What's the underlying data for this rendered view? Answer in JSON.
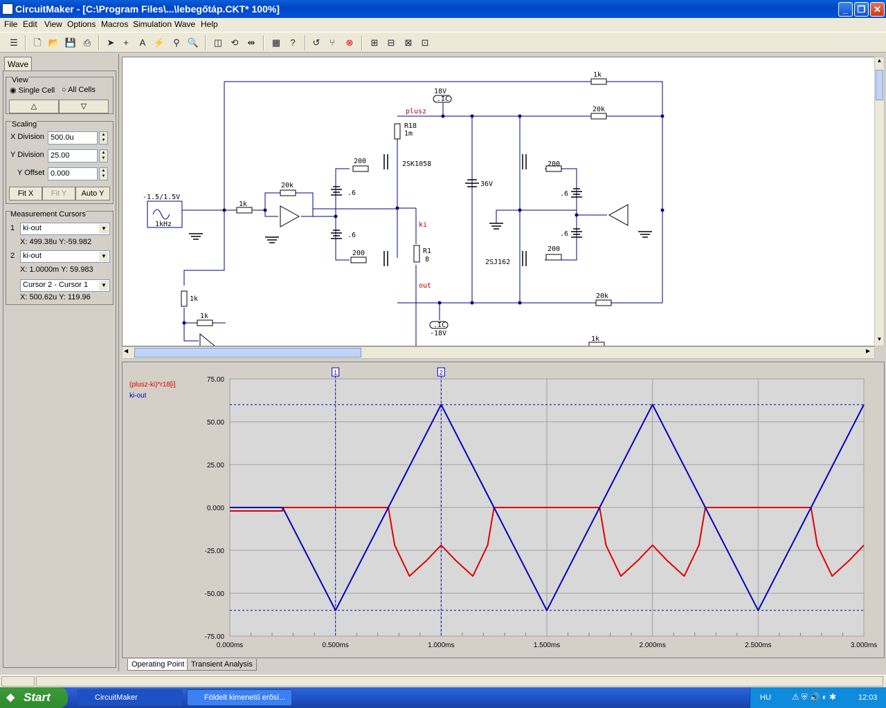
{
  "window": {
    "title": "CircuitMaker - [C:\\Program Files\\...\\lebegőtáp.CKT* 100%]"
  },
  "menu": [
    "File",
    "Edit",
    "View",
    "Options",
    "Macros",
    "Simulation",
    "Wave",
    "Help"
  ],
  "panel": {
    "tab": "Wave",
    "view_title": "View",
    "single_cell": "Single Cell",
    "all_cells": "All Cells",
    "scaling_title": "Scaling",
    "x_div_label": "X Division",
    "x_div_value": "500.0u",
    "y_div_label": "Y Division",
    "y_div_value": "25.00",
    "y_off_label": "Y Offset",
    "y_off_value": "0.000",
    "fit_x": "Fit X",
    "fit_y": "Fit Y",
    "auto_y": "Auto Y",
    "cursors_title": "Measurement Cursors",
    "c1_num": "1",
    "c1_signal": "ki-out",
    "c1_readout": "X: 499.38u  Y:-59.982",
    "c2_num": "2",
    "c2_signal": "ki-out",
    "c2_readout": "X: 1.0000m  Y: 59.983",
    "diff_mode": "Cursor 2 - Cursor 1",
    "diff_readout": "X: 500.62u  Y: 119.96"
  },
  "schematic": {
    "labels": [
      "1k",
      "18V",
      ".IC",
      "plusz",
      "20k",
      "R18",
      "1m",
      "2SK1058",
      "200",
      ".6",
      "36V",
      "200",
      ".6",
      "-1.5/1.5V",
      "1kHz",
      "1k",
      "20k",
      ".6",
      ".6",
      "200",
      "ki",
      "R1",
      "8",
      "out",
      "2SJ162",
      "200",
      "20k",
      ".IC",
      "-18V",
      "1k",
      "1k",
      "1k"
    ]
  },
  "chart_data": {
    "type": "line",
    "title": "",
    "x_unit": "ms",
    "xlim": [
      0,
      3.0
    ],
    "ylim": [
      -75,
      75
    ],
    "x_ticks": [
      "0.000ms",
      "0.500ms",
      "1.000ms",
      "1.500ms",
      "2.000ms",
      "2.500ms",
      "3.000ms"
    ],
    "y_ticks": [
      "75.00",
      "50.00",
      "25.00",
      "0.000",
      "-25.00",
      "-50.00",
      "-75.00"
    ],
    "series": [
      {
        "name": "(plusz-ki)*r18[i]",
        "color": "#e00000",
        "points": [
          [
            0,
            -2
          ],
          [
            0.25,
            -2
          ],
          [
            0.25,
            0
          ],
          [
            0.75,
            0
          ],
          [
            0.78,
            -22
          ],
          [
            0.85,
            -40
          ],
          [
            0.93,
            -31
          ],
          [
            1.0,
            -22
          ],
          [
            1.07,
            -31
          ],
          [
            1.15,
            -40
          ],
          [
            1.22,
            -22
          ],
          [
            1.25,
            0
          ],
          [
            1.75,
            0
          ],
          [
            1.78,
            -22
          ],
          [
            1.85,
            -40
          ],
          [
            1.93,
            -31
          ],
          [
            2.0,
            -22
          ],
          [
            2.07,
            -31
          ],
          [
            2.15,
            -40
          ],
          [
            2.22,
            -22
          ],
          [
            2.25,
            0
          ],
          [
            2.75,
            0
          ],
          [
            2.78,
            -22
          ],
          [
            2.85,
            -40
          ],
          [
            2.93,
            -31
          ],
          [
            3.0,
            -22
          ]
        ]
      },
      {
        "name": "ki-out",
        "color": "#0000c0",
        "points": [
          [
            0,
            0
          ],
          [
            0.25,
            0
          ],
          [
            0.5,
            -60
          ],
          [
            0.75,
            0
          ],
          [
            1.0,
            60
          ],
          [
            1.25,
            0
          ],
          [
            1.5,
            -60
          ],
          [
            1.75,
            0
          ],
          [
            2.0,
            60
          ],
          [
            2.25,
            0
          ],
          [
            2.5,
            -60
          ],
          [
            2.75,
            0
          ],
          [
            3.0,
            60
          ]
        ]
      }
    ],
    "cursors": [
      {
        "label": "1",
        "x": 0.5
      },
      {
        "label": "2",
        "x": 1.0
      }
    ],
    "reference_lines_y": [
      60,
      -60
    ]
  },
  "bottom_tabs": [
    "Operating Point",
    "Transient Analysis"
  ],
  "taskbar": {
    "start": "Start",
    "task1": "CircuitMaker",
    "task2": "Földelt kimenetű erősí...",
    "lang": "HU",
    "clock": "12:03"
  }
}
